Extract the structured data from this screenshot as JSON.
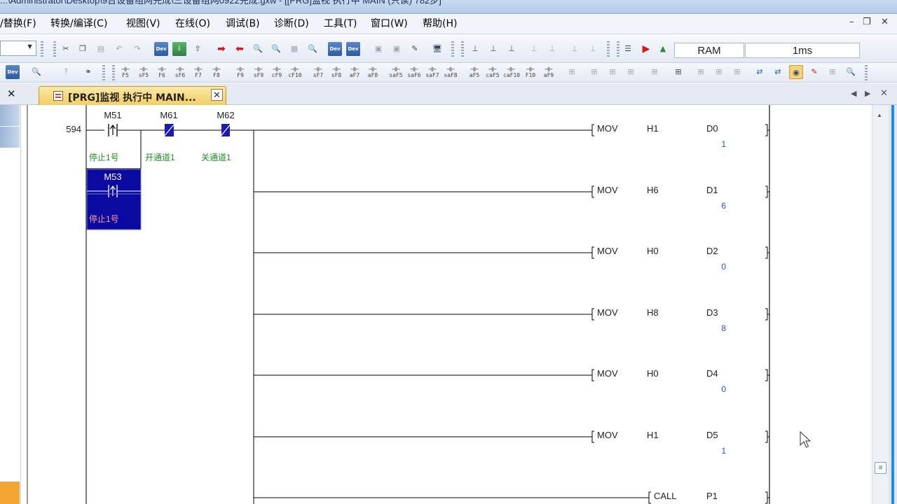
{
  "window": {
    "title": "...\\Administrator\\Desktop\\9台设备组网完成\\三设备组网0922完成.gxw - [[PRG]监视 执行中 MAIN (只读) 782步]",
    "controls": [
      "–",
      "❐",
      "✕"
    ]
  },
  "menu": [
    "/替换(F)",
    "转换/编译(C)",
    "视图(V)",
    "在线(O)",
    "调试(B)",
    "诊断(D)",
    "工具(T)",
    "窗口(W)",
    "帮助(H)"
  ],
  "toolbar": {
    "status_ram": "RAM",
    "status_scan": "1ms",
    "fkeys": [
      "F5",
      "sF5",
      "F6",
      "sF6",
      "F7",
      "F8",
      "F9",
      "sF9",
      "cF9",
      "cF10",
      "sF7",
      "sF8",
      "aF7",
      "aF8",
      "saF5",
      "saF6",
      "saF7",
      "saF8",
      "aF5",
      "caF5",
      "caF10",
      "F10",
      "aF9"
    ]
  },
  "tab": {
    "label": "[PRG]监视 执行中 MAIN...",
    "close": "✕",
    "left_close": "✕",
    "nav_prev": "◀",
    "nav_next": "▶",
    "nav_close": "✕"
  },
  "ladder": {
    "step": "594",
    "contacts": [
      {
        "device": "M51",
        "comment": "停止1号",
        "state": "off",
        "type": "rising"
      },
      {
        "device": "M61",
        "comment": "开通道1",
        "state": "on",
        "type": "nc"
      },
      {
        "device": "M62",
        "comment": "关通道1",
        "state": "on",
        "type": "nc"
      },
      {
        "device": "M53",
        "comment": "停止1号",
        "state": "selected",
        "type": "rising"
      }
    ],
    "instructions": [
      {
        "op": "MOV",
        "src": "H1",
        "dst": "D0",
        "value": "1"
      },
      {
        "op": "MOV",
        "src": "H6",
        "dst": "D1",
        "value": "6"
      },
      {
        "op": "MOV",
        "src": "H0",
        "dst": "D2",
        "value": "0"
      },
      {
        "op": "MOV",
        "src": "H8",
        "dst": "D3",
        "value": "8"
      },
      {
        "op": "MOV",
        "src": "H0",
        "dst": "D4",
        "value": "0"
      },
      {
        "op": "MOV",
        "src": "H1",
        "dst": "D5",
        "value": "1"
      },
      {
        "op": "CALL",
        "src": "P1",
        "dst": "",
        "value": ""
      }
    ]
  },
  "colors": {
    "active_contact": "#1a1ab8",
    "comment_text": "#1e8f1e",
    "monitor_value": "#2450d8",
    "selection": "#0a0aa0",
    "tab_active": "#f3cf62"
  }
}
